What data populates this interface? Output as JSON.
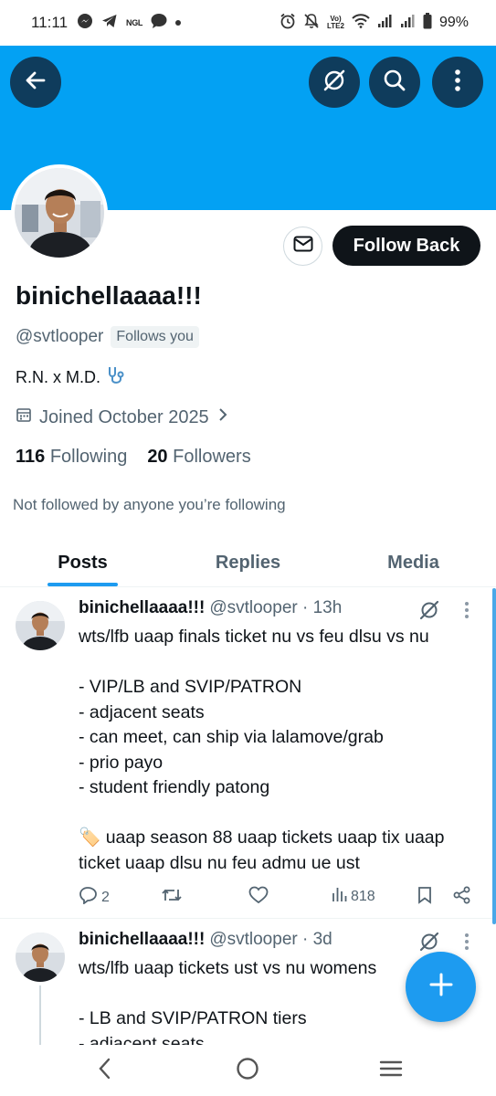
{
  "status_bar": {
    "time": "11:11",
    "notification_icons": [
      "messenger-icon",
      "telegram-icon",
      "ngl-icon",
      "chat-bubble-icon",
      "dot-icon"
    ],
    "ngl_label": "NGL",
    "volte_label_top": "Vo)",
    "volte_label_bottom": "LTE2",
    "battery": "99%"
  },
  "header": {
    "banner_color": "#03a1f3",
    "buttons": [
      "back-arrow-icon",
      "grok-icon",
      "search-icon",
      "more-vertical-icon"
    ]
  },
  "profile": {
    "display_name": "binichellaaaa!!!",
    "handle": "@svtlooper",
    "follows_you": "Follows you",
    "bio": "R.N. x M.D.",
    "bio_emoji": "stethoscope-icon",
    "joined": "Joined October 2025",
    "following_count": "116",
    "following_label": "Following",
    "followers_count": "20",
    "followers_label": "Followers",
    "not_followed": "Not followed by anyone you’re following",
    "follow_back_label": "Follow Back"
  },
  "tabs": [
    {
      "label": "Posts",
      "active": true
    },
    {
      "label": "Replies",
      "active": false
    },
    {
      "label": "Media",
      "active": false
    }
  ],
  "posts": [
    {
      "name": "binichellaaaa!!!",
      "meta": "@svtlooper · 13h",
      "body": "wts/lfb uaap finals ticket nu vs feu dlsu vs nu\n\n- VIP/LB and SVIP/PATRON\n- adjacent seats\n- can meet, can ship via lalamove/grab\n- prio payo\n- student friendly patong\n\n🏷️ uaap season 88 uaap tickets uaap tix uaap ticket uaap dlsu nu feu admu ue ust",
      "replies": "2",
      "views": "818"
    },
    {
      "name": "binichellaaaa!!!",
      "meta": "@svtlooper · 3d",
      "body": "wts/lfb uaap tickets ust vs nu womens\n\n- LB and SVIP/PATRON tiers\n- adjacent seats"
    }
  ],
  "colors": {
    "accent": "#1d9bf0",
    "dark": "#0f1419",
    "muted": "#536471"
  }
}
